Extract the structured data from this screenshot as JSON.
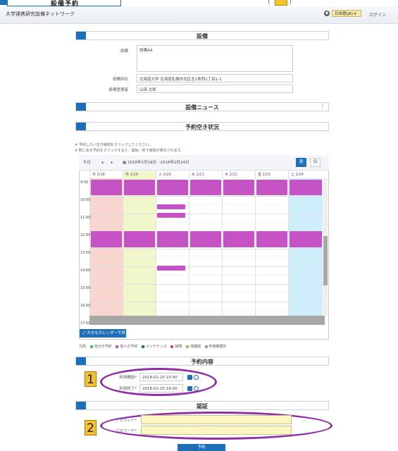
{
  "top": {
    "label": "設備予約",
    "badge": ""
  },
  "header": {
    "site_title": "大学連携研究設備ネットワーク",
    "lang": "日本語(JA)",
    "login": "ログイン"
  },
  "equipment": {
    "section_title": "設備",
    "labels": {
      "equipment": "設備",
      "location": "設備所在",
      "manager": "設備管理者"
    },
    "equipment_value": "設備AA",
    "location_value": "北海道大学 北海道札幌市北区北1条西1丁目1-1",
    "manager_value": "山田 太郎"
  },
  "news": {
    "section_title": "設備ニュース",
    "menu": "⋮"
  },
  "availability": {
    "section_title": "予約空き状況",
    "notes": [
      "※ 予約したい空き時間をクリックしてください。",
      "※ 既にある予約をクリックすると、開始／終了時間が表示されます。"
    ]
  },
  "calendar": {
    "today": "今日",
    "prev": "◂",
    "next": "▸",
    "range": "2018年2月19日 - 2018年2月24日",
    "week": "週",
    "day": "日",
    "columns": [
      "月 2/18",
      "月 2/19",
      "火 2/20",
      "水 2/21",
      "木 2/22",
      "金 2/23",
      "土 2/24"
    ],
    "times": [
      "9:00",
      "10:00",
      "11:00",
      "12:00",
      "13:00",
      "14:00",
      "15:00",
      "16:00",
      "17:00"
    ],
    "big_calendar": "大きなカレンダーで見る"
  },
  "legend": {
    "prefix": "凡例",
    "items": [
      {
        "label": "自分の予約",
        "color": "#5cb85c"
      },
      {
        "label": "他人の予約",
        "color": "#c653c6"
      },
      {
        "label": "メンテナンス",
        "color": "#1d6fb8"
      },
      {
        "label": "故障",
        "color": "#d9534f"
      },
      {
        "label": "他機関",
        "color": "#8fbf5a"
      },
      {
        "label": "利用期間外",
        "color": "#9aa0a6"
      }
    ]
  },
  "reservation": {
    "section_title": "予約内容",
    "start_label": "利用開始*",
    "end_label": "利用終了*",
    "start_value": "2018-02-20 15:00",
    "end_value": "2018-02-20 18:00"
  },
  "auth": {
    "section_title": "認証",
    "account_label": "アカウント*",
    "password_label": "パスワード*"
  },
  "annotations": {
    "badge1": "1",
    "badge2": "2"
  },
  "submit": "予約"
}
